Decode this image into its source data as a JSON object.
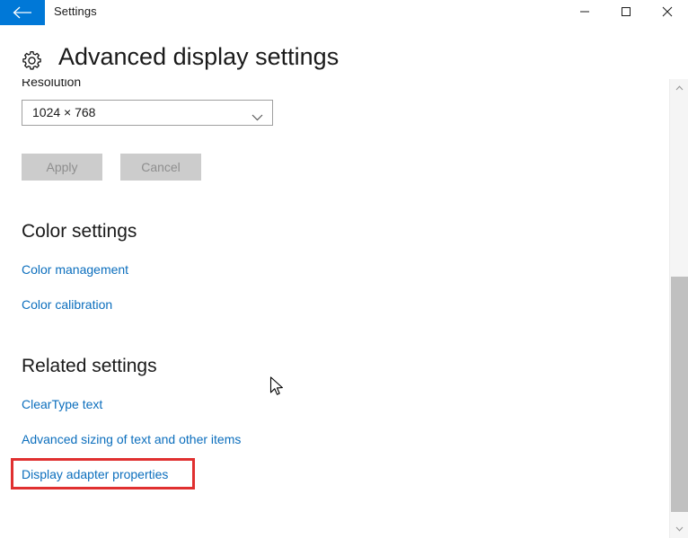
{
  "window": {
    "app_title": "Settings",
    "back_label": "Back",
    "controls": {
      "minimize": "Minimize",
      "maximize": "Maximize",
      "close": "Close"
    },
    "accent_color": "#0078d7",
    "link_color": "#0b6ebd",
    "highlight_color": "#e03030"
  },
  "page": {
    "title": "Advanced display settings",
    "icon": "gear-icon"
  },
  "resolution": {
    "label": "Resolution",
    "value": "1024 × 768",
    "apply_label": "Apply",
    "cancel_label": "Cancel",
    "buttons_disabled": true
  },
  "color_settings": {
    "heading": "Color settings",
    "links": [
      "Color management",
      "Color calibration"
    ]
  },
  "related_settings": {
    "heading": "Related settings",
    "links": [
      "ClearType text",
      "Advanced sizing of text and other items"
    ],
    "highlighted_link": "Display adapter properties"
  },
  "scrollbar": {
    "up_arrow": "▲",
    "down_arrow": "▼"
  }
}
